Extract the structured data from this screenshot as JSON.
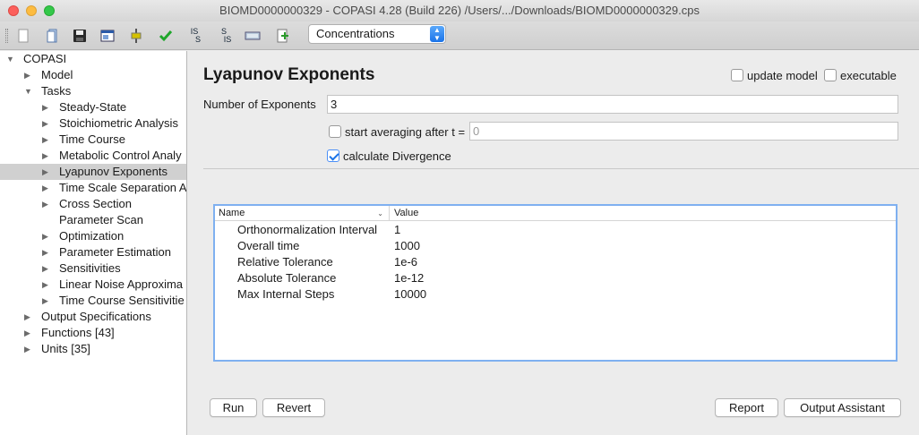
{
  "window": {
    "title": "BIOMD0000000329 - COPASI 4.28 (Build 226) /Users/.../Downloads/BIOMD0000000329.cps"
  },
  "toolbar": {
    "combo_value": "Concentrations",
    "buttons": [
      "new-file-icon",
      "open-file-icon",
      "save-icon",
      "screenshot-icon",
      "slider-icon",
      "check-icon",
      "is-s-icon",
      "s-is-icon",
      "sbw-icon",
      "add-page-icon"
    ],
    "is_s_label": "IS\nS",
    "s_is_label": "S\nIS"
  },
  "tree": {
    "root": "COPASI",
    "items": [
      {
        "label": "Model",
        "level": 1,
        "arrow": "right"
      },
      {
        "label": "Tasks",
        "level": 1,
        "arrow": "down"
      },
      {
        "label": "Steady-State",
        "level": 2,
        "arrow": "right"
      },
      {
        "label": "Stoichiometric Analysis",
        "level": 2,
        "arrow": "right"
      },
      {
        "label": "Time Course",
        "level": 2,
        "arrow": "right"
      },
      {
        "label": "Metabolic Control Analy",
        "level": 2,
        "arrow": "right"
      },
      {
        "label": "Lyapunov Exponents",
        "level": 2,
        "arrow": "right",
        "selected": true
      },
      {
        "label": "Time Scale Separation A",
        "level": 2,
        "arrow": "right"
      },
      {
        "label": "Cross Section",
        "level": 2,
        "arrow": "right"
      },
      {
        "label": "Parameter Scan",
        "level": 2,
        "arrow": ""
      },
      {
        "label": "Optimization",
        "level": 2,
        "arrow": "right"
      },
      {
        "label": "Parameter Estimation",
        "level": 2,
        "arrow": "right"
      },
      {
        "label": "Sensitivities",
        "level": 2,
        "arrow": "right"
      },
      {
        "label": "Linear Noise Approxima",
        "level": 2,
        "arrow": "right"
      },
      {
        "label": "Time Course Sensitivitie",
        "level": 2,
        "arrow": "right"
      },
      {
        "label": "Output Specifications",
        "level": 1,
        "arrow": "right"
      },
      {
        "label": "Functions [43]",
        "level": 1,
        "arrow": "right"
      },
      {
        "label": "Units [35]",
        "level": 1,
        "arrow": "right"
      }
    ]
  },
  "panel": {
    "title": "Lyapunov Exponents",
    "update_model_label": "update model",
    "executable_label": "executable",
    "num_exponents_label": "Number of Exponents",
    "num_exponents_value": "3",
    "start_averaging_label": "start averaging after t =",
    "start_averaging_value": "0",
    "calc_divergence_label": "calculate Divergence",
    "calc_divergence_checked": true,
    "update_model_checked": false,
    "executable_checked": false,
    "start_averaging_checked": false
  },
  "table": {
    "columns": [
      "Name",
      "Value"
    ],
    "rows": [
      {
        "name": "Orthonormalization Interval",
        "value": "1"
      },
      {
        "name": "Overall time",
        "value": "1000"
      },
      {
        "name": "Relative Tolerance",
        "value": "1e-6"
      },
      {
        "name": "Absolute Tolerance",
        "value": "1e-12"
      },
      {
        "name": "Max Internal Steps",
        "value": "10000"
      }
    ]
  },
  "buttons": {
    "run": "Run",
    "revert": "Revert",
    "report": "Report",
    "output_assistant": "Output Assistant"
  },
  "colors": {
    "accent": "#1a73e8",
    "selection": "#d0d0d0",
    "focus_border": "#7fb0f0"
  }
}
